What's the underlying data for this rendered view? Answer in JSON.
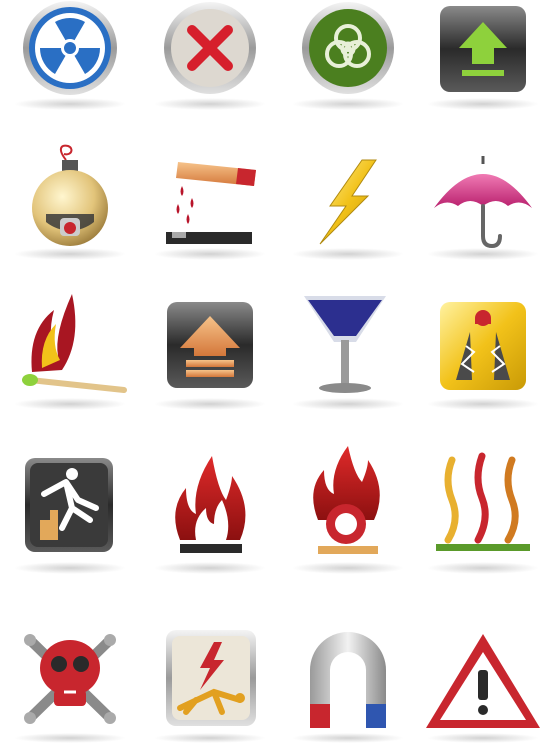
{
  "icon_sheet": {
    "rows": [
      [
        "radiation-icon",
        "cross-icon",
        "biohazard-icon",
        "this-side-up-icon"
      ],
      [
        "bomb-icon",
        "corrosive-icon",
        "high-voltage-icon",
        "keep-dry-umbrella-icon"
      ],
      [
        "flammable-match-icon",
        "arrow-up-box-icon",
        "fragile-glass-icon",
        "road-hazard-icon"
      ],
      [
        "slippery-stairs-icon",
        "fire-icon",
        "oxidizer-icon",
        "hot-surface-icon"
      ],
      [
        "skull-crossbones-icon",
        "electric-shock-icon",
        "magnet-icon",
        "warning-triangle-icon"
      ]
    ],
    "colors": {
      "radiation_blue": "#2a6fc4",
      "cross_red": "#d61f2c",
      "biohazard_green": "#4b7f1f",
      "arrow_green": "#8ed13c",
      "umbrella_pink": "#d9428f",
      "bolt_yellow": "#f2c21a",
      "glass_blue": "#2c2f8f",
      "fire_red": "#b01a1a",
      "magnet_red": "#c8262e",
      "magnet_blue": "#2f56b0",
      "warning_red": "#c8262e"
    }
  }
}
